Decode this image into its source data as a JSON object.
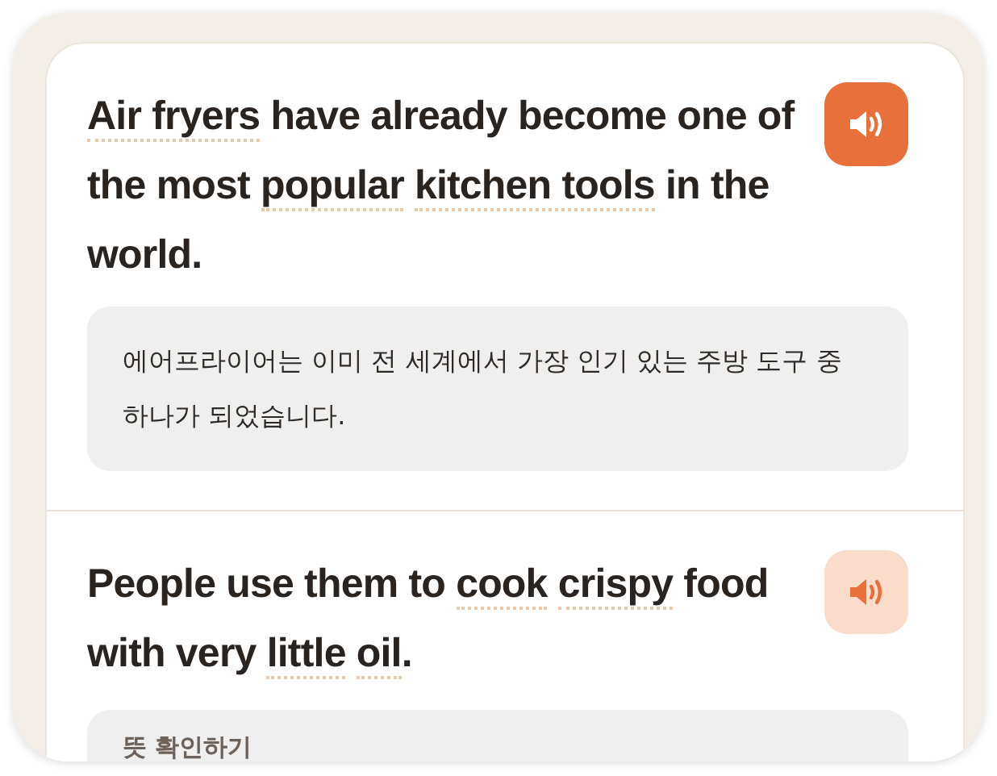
{
  "cards": [
    {
      "sentence": [
        {
          "text": "Air fryers",
          "vocab": true
        },
        {
          "text": " have already become one of the most ",
          "vocab": false
        },
        {
          "text": "popular",
          "vocab": true
        },
        {
          "text": "kitchen tools",
          "vocab": true,
          "space_before": true
        },
        {
          "text": " in the world.",
          "vocab": false
        }
      ],
      "audio_active": true,
      "translation": {
        "kind": "text",
        "text": "에어프라이어는 이미 전 세계에서 가장 인기 있는 주방 도구 중 하나가 되었습니다."
      }
    },
    {
      "sentence": [
        {
          "text": "People use them to ",
          "vocab": false
        },
        {
          "text": "cook",
          "vocab": true
        },
        {
          "text": "crispy",
          "vocab": true,
          "space_before": true
        },
        {
          "text": " food with very ",
          "vocab": false
        },
        {
          "text": "little",
          "vocab": true
        },
        {
          "text": "oil",
          "vocab": true,
          "space_before": true
        },
        {
          "text": ".",
          "vocab": false
        }
      ],
      "audio_active": false,
      "translation": {
        "kind": "reveal",
        "text": "뜻 확인하기"
      }
    }
  ]
}
